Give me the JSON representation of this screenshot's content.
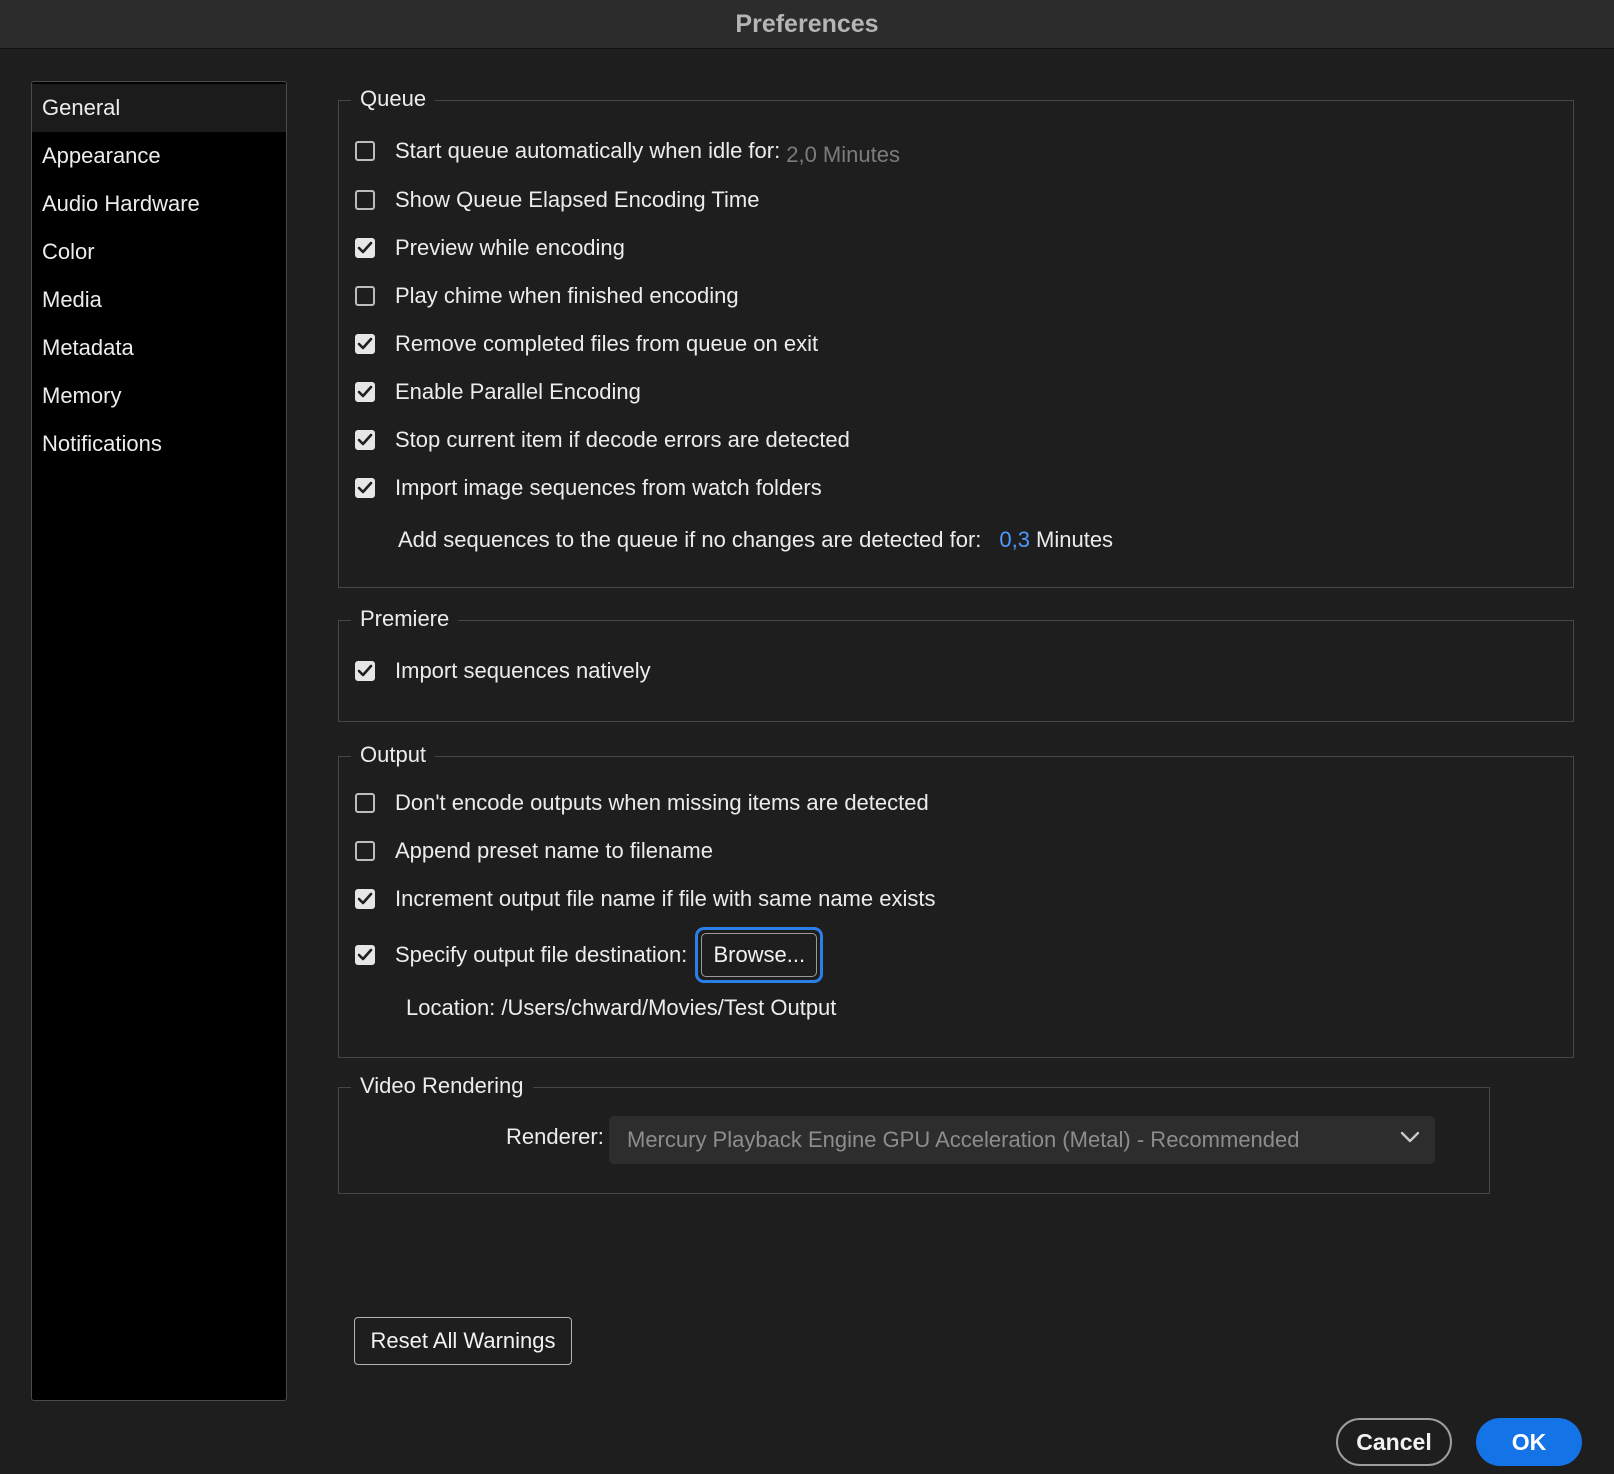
{
  "window": {
    "title": "Preferences"
  },
  "sidebar": {
    "items": [
      {
        "label": "General"
      },
      {
        "label": "Appearance"
      },
      {
        "label": "Audio Hardware"
      },
      {
        "label": "Color"
      },
      {
        "label": "Media"
      },
      {
        "label": "Metadata"
      },
      {
        "label": "Memory"
      },
      {
        "label": "Notifications"
      }
    ],
    "selected": "General"
  },
  "queue": {
    "title": "Queue",
    "start_queue": {
      "label": "Start queue automatically when idle for:",
      "checked": false,
      "value": "2,0 Minutes"
    },
    "show_elapsed": {
      "label": "Show Queue Elapsed Encoding Time",
      "checked": false
    },
    "preview": {
      "label": "Preview while encoding",
      "checked": true
    },
    "chime": {
      "label": "Play chime when finished encoding",
      "checked": false
    },
    "remove_completed": {
      "label": "Remove completed files from queue on exit",
      "checked": true
    },
    "parallel": {
      "label": "Enable Parallel Encoding",
      "checked": true
    },
    "stop_on_error": {
      "label": "Stop current item if decode errors are detected",
      "checked": true
    },
    "import_sequences": {
      "label": "Import image sequences from watch folders",
      "checked": true
    },
    "add_sequences": {
      "label": "Add sequences to the queue if no changes are detected for:",
      "value": "0,3",
      "unit": "Minutes"
    }
  },
  "premiere": {
    "title": "Premiere",
    "import_native": {
      "label": "Import sequences natively",
      "checked": true
    }
  },
  "output": {
    "title": "Output",
    "dont_encode": {
      "label": "Don't encode outputs when missing items are detected",
      "checked": false
    },
    "append_preset": {
      "label": "Append preset name to filename",
      "checked": false
    },
    "increment": {
      "label": "Increment output file name if file with same name exists",
      "checked": true
    },
    "specify_destination": {
      "label": "Specify output file destination:",
      "checked": true
    },
    "browse_label": "Browse...",
    "location": "Location: /Users/chward/Movies/Test Output"
  },
  "video_rendering": {
    "title": "Video Rendering",
    "renderer_label": "Renderer:",
    "renderer_value": "Mercury Playback Engine GPU Acceleration (Metal) - Recommended"
  },
  "footer": {
    "reset_label": "Reset All Warnings",
    "cancel_label": "Cancel",
    "ok_label": "OK"
  },
  "colors": {
    "accent": "#1473e6",
    "focus_ring": "#2b7fe9",
    "value_blue": "#4b9bff"
  }
}
